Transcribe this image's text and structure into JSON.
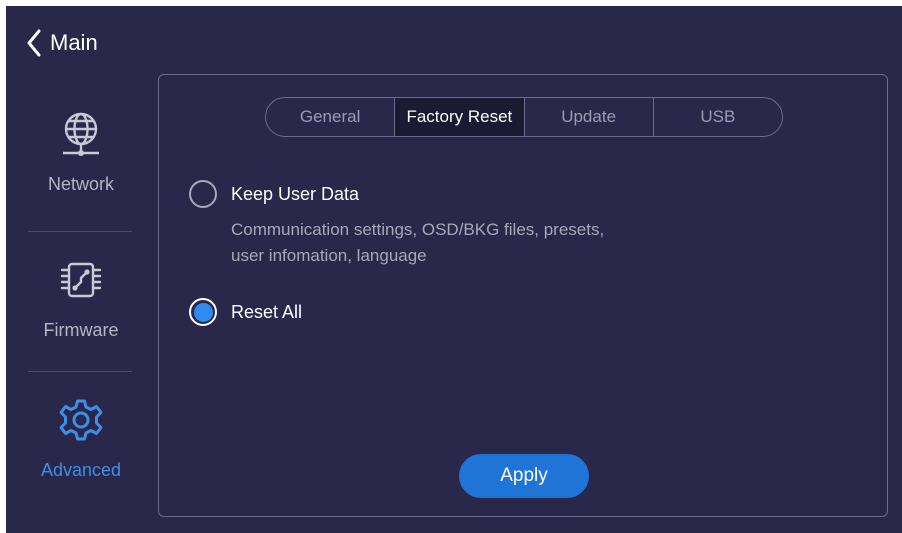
{
  "header": {
    "back_icon": "chevron-left-icon",
    "title": "Main"
  },
  "sidebar": {
    "items": [
      {
        "label": "Network",
        "icon": "globe-network-icon",
        "active": false
      },
      {
        "label": "Firmware",
        "icon": "chip-icon",
        "active": false
      },
      {
        "label": "Advanced",
        "icon": "gear-icon",
        "active": true
      }
    ]
  },
  "tabs": [
    {
      "label": "General",
      "active": false
    },
    {
      "label": "Factory Reset",
      "active": true
    },
    {
      "label": "Update",
      "active": false
    },
    {
      "label": "USB",
      "active": false
    }
  ],
  "options": {
    "keep_user_data": {
      "label": "Keep User Data",
      "selected": false,
      "description_line1": "Communication settings, OSD/BKG files, presets,",
      "description_line2": "user infomation, language"
    },
    "reset_all": {
      "label": "Reset All",
      "selected": true
    }
  },
  "apply_button": {
    "label": "Apply"
  },
  "colors": {
    "background": "#29284a",
    "accent": "#2f8bf0",
    "active_text": "#3e8ee8",
    "border": "#6c6b88"
  }
}
